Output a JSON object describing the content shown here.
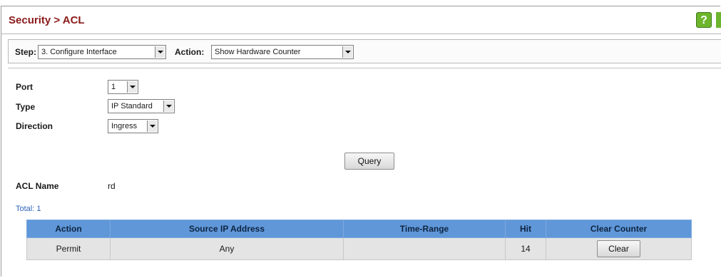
{
  "header": {
    "title": "Security > ACL",
    "help_icon_glyph": "?"
  },
  "step": {
    "step_label": "Step:",
    "step_value": "3. Configure Interface",
    "action_label": "Action:",
    "action_value": "Show Hardware Counter"
  },
  "form": {
    "port_label": "Port",
    "port_value": "1",
    "type_label": "Type",
    "type_value": "IP Standard",
    "direction_label": "Direction",
    "direction_value": "Ingress",
    "query_label": "Query",
    "acl_name_label": "ACL Name",
    "acl_name_value": "rd"
  },
  "table": {
    "total": "Total: 1",
    "headers": [
      "Action",
      "Source IP Address",
      "Time-Range",
      "Hit",
      "Clear Counter"
    ],
    "rows": [
      {
        "action": "Permit",
        "source_ip": "Any",
        "time_range": "",
        "hit": "14",
        "clear_label": "Clear"
      }
    ]
  },
  "colors": {
    "title": "#8b1a1a",
    "table_header": "#5f97d9",
    "help_icon": "#6cb52d"
  }
}
